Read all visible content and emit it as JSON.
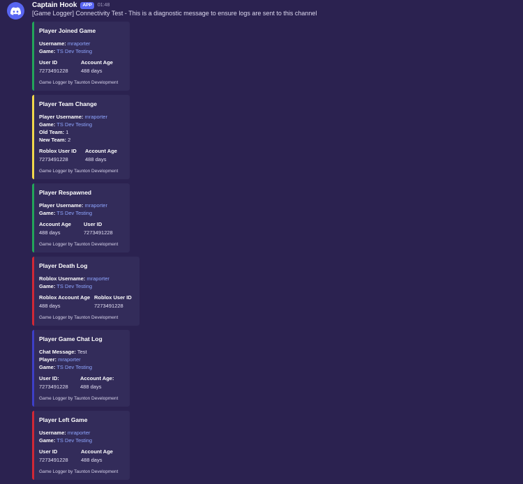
{
  "message": {
    "author": "Captain Hook",
    "badge": "APP",
    "time": "01:48",
    "content": "[Game Logger] Connectivity Test - This is a diagnostic message to ensure logs are sent to this channel"
  },
  "colors": {
    "green": "#23a55a",
    "yellow": "#f0d84b",
    "red": "#d02836",
    "blue": "#3d3fc7",
    "link": "#8fa6ff",
    "brand": "#5865f2"
  },
  "embeds": [
    {
      "title": "Player Joined Game",
      "lines": [
        {
          "label": "Username:",
          "value": "mraporter"
        },
        {
          "label": "Game:",
          "value": "TS Dev Testing"
        }
      ],
      "inline": [
        {
          "name": "User ID",
          "value": "7273491228"
        },
        {
          "name": "Account Age",
          "value": "488 days"
        }
      ],
      "footer": "Game Logger by Taunton Development"
    },
    {
      "title": "Player Team Change",
      "lines": [
        {
          "label": "Player Username:",
          "value": "mraporter"
        },
        {
          "label": "Game:",
          "value": "TS Dev Testing"
        },
        {
          "label": "Old Team:",
          "value": "1"
        },
        {
          "label": "New Team:",
          "value": "2"
        }
      ],
      "inline": [
        {
          "name": "Roblox User ID",
          "value": "7273491228"
        },
        {
          "name": "Account Age",
          "value": "488 days"
        }
      ],
      "footer": "Game Logger by Taunton Development"
    },
    {
      "title": "Player Respawned",
      "lines": [
        {
          "label": "Player Username:",
          "value": "mraporter"
        },
        {
          "label": "Game:",
          "value": "TS Dev Testing"
        }
      ],
      "inline": [
        {
          "name": "Account Age",
          "value": "488 days"
        },
        {
          "name": "User ID",
          "value": "7273491228"
        }
      ],
      "footer": "Game Logger by Taunton Development"
    },
    {
      "title": "Player Death Log",
      "lines": [
        {
          "label": "Roblox Username:",
          "value": "mraporter"
        },
        {
          "label": "Game:",
          "value": "TS Dev Testing"
        }
      ],
      "inline": [
        {
          "name": "Roblox Account Age",
          "value": "488 days"
        },
        {
          "name": "Roblox User ID",
          "value": "7273491228"
        }
      ],
      "footer": "Game Logger by Taunton Development"
    },
    {
      "title": "Player Game Chat Log",
      "lines": [
        {
          "label": "Chat Message:",
          "value": "Test"
        },
        {
          "label": "Player:",
          "value": "mraporter"
        },
        {
          "label": "Game:",
          "value": "TS Dev Testing"
        }
      ],
      "inline": [
        {
          "name": "User ID:",
          "value": "7273491228"
        },
        {
          "name": "Account Age:",
          "value": "488 days"
        }
      ],
      "footer": "Game Logger by Taunton Development"
    },
    {
      "title": "Player Left Game",
      "lines": [
        {
          "label": "Username:",
          "value": "mraporter"
        },
        {
          "label": "Game:",
          "value": "TS Dev Testing"
        }
      ],
      "inline": [
        {
          "name": "User ID",
          "value": "7273491228"
        },
        {
          "name": "Account Age",
          "value": "488 days"
        }
      ],
      "footer": "Game Logger by Taunton Development"
    }
  ]
}
